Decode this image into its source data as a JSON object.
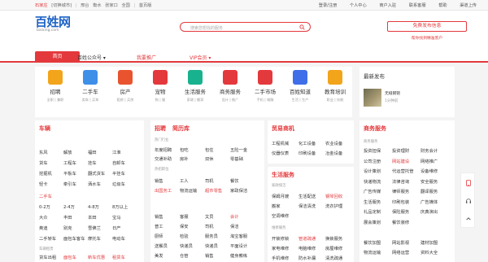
{
  "topbar": {
    "cities": [
      "石家庄",
      "[切换城市]",
      "邢台",
      "衡水",
      "张家口",
      "全国",
      "首页版"
    ],
    "links": [
      "登录/注册",
      "个人中心",
      "商户入驻",
      "联系客服",
      "帮助",
      "渠道上传"
    ]
  },
  "logo": {
    "name": "百姓网",
    "domain": "baixing.com"
  },
  "search": {
    "placeholder": "搜索您想找的服务"
  },
  "post": {
    "button": "免费发布信息",
    "sub": "帮你找到精准客户"
  },
  "nav": {
    "items": [
      "首页",
      "百姓公众号 ▾",
      "我要推广",
      "VIP会员 ▾"
    ]
  },
  "categories": [
    {
      "title": "招聘",
      "sub": "全职 | 兼职",
      "icon": "job-icon",
      "color": "#f2a51a"
    },
    {
      "title": "二手车",
      "sub": "卖车 | 买车",
      "icon": "car-icon",
      "color": "#3e8fe8"
    },
    {
      "title": "房产",
      "sub": "租房 | 买房",
      "icon": "house-icon",
      "color": "#e9542f"
    },
    {
      "title": "宠物",
      "sub": "狗 | 猫",
      "icon": "pet-icon",
      "color": "#e4393c"
    },
    {
      "title": "生活服务",
      "sub": "家政 | 搬家",
      "icon": "service-icon",
      "color": "#19b28f"
    },
    {
      "title": "商务服务",
      "sub": "设计 | 推广",
      "icon": "business-icon",
      "color": "#e4393c"
    },
    {
      "title": "二手市场",
      "sub": "手机 | 电脑",
      "icon": "cart-icon",
      "color": "#e4393c"
    },
    {
      "title": "百姓知道",
      "sub": "生活 | 生产",
      "icon": "knowledge-icon",
      "color": "#3e6ee8"
    },
    {
      "title": "教育培训",
      "sub": "职业 | 技能",
      "icon": "education-icon",
      "color": "#f2a51a"
    }
  ],
  "news": {
    "heading": "最新发布",
    "name": "无缝钢管",
    "time": "1分钟前"
  },
  "car": {
    "title": "车辆",
    "rows": [
      [
        "东风",
        "解放",
        "福田",
        "江淮"
      ],
      [
        "货车",
        "工程车",
        "挂车",
        "自卸车"
      ],
      [
        "挖掘机",
        "平板车",
        "翻式货车",
        "半挂车"
      ],
      [
        "轻卡",
        "牵引车",
        "洒水车",
        "垃圾车"
      ],
      [
        "二手车",
        "",
        "",
        ""
      ],
      [
        "0-2万",
        "2-4万",
        "4-8万",
        "8万以上"
      ],
      [
        "大众",
        "丰田",
        "本田",
        "宝马"
      ],
      [
        "奥迪",
        "别克",
        "雪佛兰",
        "日产"
      ],
      [
        "二手轿车",
        "面包车客车",
        "摩托车",
        "电动车"
      ]
    ],
    "rental_label": "车辆租赁",
    "rental": [
      "货车出租",
      "面包车",
      "新车优惠",
      "租赁车"
    ]
  },
  "jobs": {
    "title": "招聘",
    "title2": "简历库",
    "rows": [
      {
        "label": "餐饮娱乐",
        "items": [
          "服务员",
          "厨师",
          "收银员",
          "保洁员"
        ]
      },
      {
        "label": "物流运输",
        "items": [
          "普工",
          "司机",
          "骑手",
          "快递员"
        ]
      },
      {
        "label": "技工类别",
        "items": [
          "销售",
          "文员",
          "会计",
          "客服"
        ]
      },
      {
        "label": "销售客服",
        "items": [
          "电工",
          "焊工",
          "保安",
          "保姆"
        ]
      },
      {
        "label": "其他",
        "items": [
          "出纳",
          "导购",
          "美容",
          "其他"
        ]
      }
    ],
    "block1": [
      [
        "年度招聘",
        "包吃",
        "包住",
        "五险一金"
      ],
      [
        "交通补助",
        "房补",
        "双休",
        "零基础"
      ]
    ],
    "block1_label": "热门行业",
    "block2": [
      [
        "销售",
        "工人",
        "司机",
        "餐饮"
      ],
      [
        "出国务工",
        "物流运输",
        "超市零售",
        "家政保洁"
      ]
    ],
    "block2_label": "热招职位",
    "block3": [
      [
        "销售",
        "客服",
        "文员",
        "会计"
      ],
      [
        "普工",
        "保安",
        "司机",
        "保洁"
      ],
      [
        "厨师",
        "检验",
        "服务员",
        "淘宝客服"
      ],
      [
        "送餐员",
        "快递员",
        "快递员",
        "平面设计"
      ],
      [
        "美发",
        "仓管",
        "销售",
        "健身教练"
      ]
    ]
  },
  "trade": {
    "title": "贸易商机",
    "rows": [
      [
        "工程机械",
        "化工设备",
        "农业设备"
      ],
      [
        "仪器仪表",
        "印刷设备",
        "冶金设备"
      ]
    ],
    "life_title": "生活服务",
    "life_sub": "家政保洁",
    "life_rows": [
      [
        "保姆月嫂",
        "生活配送",
        "钢琴回收"
      ],
      [
        "搬家",
        "保洁清洗",
        "洗衣护理"
      ],
      [
        "空调维修",
        "",
        ""
      ]
    ],
    "repair_sub": "维修服务",
    "repair_rows": [
      [
        "开锁修锁",
        "管道疏通",
        "换锁服务"
      ],
      [
        "家电维修",
        "电脑维修",
        "房屋维修"
      ],
      [
        "手机维修",
        "防水补漏",
        "清洗疏通"
      ]
    ]
  },
  "biz": {
    "title": "商务服务",
    "sub": "商务服务",
    "rows": [
      [
        "投资担保",
        "投资理财",
        "财务会计"
      ],
      [
        "公司注册",
        "网站建设",
        "网络推广"
      ],
      [
        "设计策划",
        "代运营托管",
        "设备维修"
      ],
      [
        "快递物流",
        "法律咨询",
        "安全服务"
      ],
      [
        "广告传媒",
        "律师服务",
        "翻译服务"
      ],
      [
        "生活服务",
        "印刷包装",
        "广告媒体"
      ],
      [
        "礼品定制",
        "保险服务",
        "庆典演出"
      ],
      [
        "展会策划",
        "餐饮装修",
        ""
      ],
      [
        "",
        "",
        ""
      ],
      [
        "餐饮加盟",
        "网站影视",
        "建材加盟"
      ],
      [
        "物流运输",
        "网络运营",
        "资料大全"
      ]
    ],
    "red": [
      "网站建设"
    ]
  }
}
